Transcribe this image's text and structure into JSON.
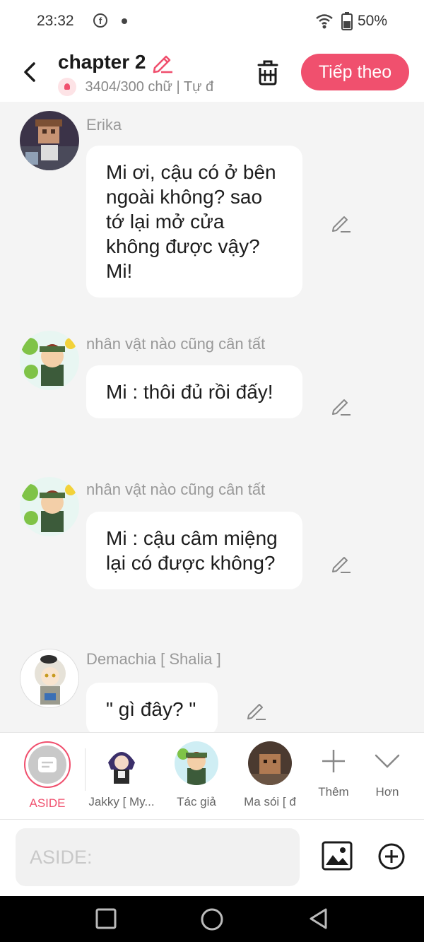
{
  "status_bar": {
    "time": "23:32",
    "battery": "50%"
  },
  "header": {
    "title": "chapter 2",
    "subtitle": "3404/300 chữ | Tự đ",
    "next_label": "Tiếp theo"
  },
  "messages": [
    {
      "speaker": "Erika",
      "text": "Mi ơi, cậu có ở bên ngoài không? sao tớ lại mở cửa không được vậy? Mi!",
      "avatar": "avatar-erika"
    },
    {
      "speaker": "nhân vật nào cũng cân tất",
      "text": "Mi : thôi đủ rồi đấy!",
      "avatar": "avatar-green-character"
    },
    {
      "speaker": "nhân vật nào cũng cân tất",
      "text": "Mi : cậu câm miệng lại có được không?",
      "avatar": "avatar-green-character"
    },
    {
      "speaker": "Demachia [ Shalia ]",
      "text": "\" gì đây? \"",
      "avatar": "avatar-demachia"
    }
  ],
  "characters": [
    {
      "label": "ASIDE",
      "active": true
    },
    {
      "label": "Jakky [ My..."
    },
    {
      "label": "Tác giả"
    },
    {
      "label": "Ma sói [ đ"
    },
    {
      "label": "Thêm",
      "icon": "plus-icon"
    },
    {
      "label": "Hơn",
      "icon": "chevron-down-icon"
    }
  ],
  "input": {
    "placeholder": "ASIDE:"
  },
  "colors": {
    "accent": "#f0506e",
    "background": "#f4f4f4",
    "bubble": "#ffffff"
  }
}
